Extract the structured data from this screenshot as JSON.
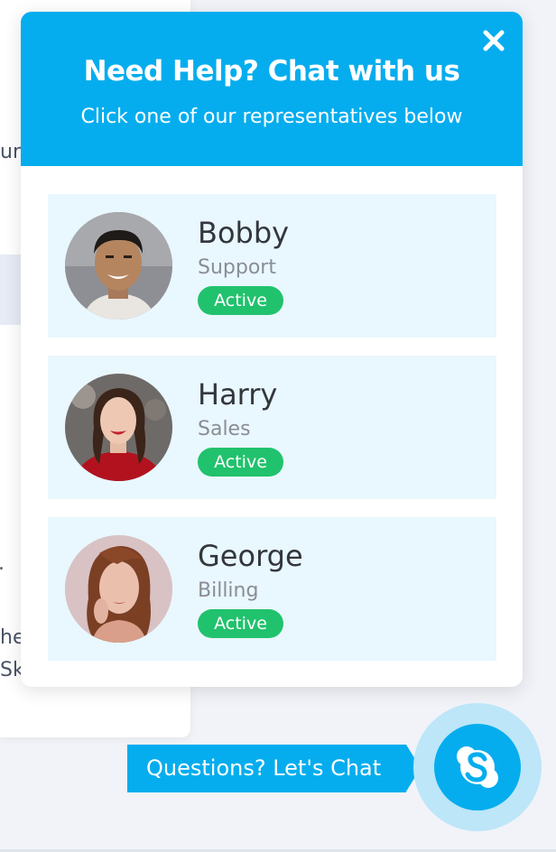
{
  "background": {
    "fragments": [
      "uri",
      ".",
      "he",
      "Sk"
    ]
  },
  "widget": {
    "title": "Need Help? Chat with us",
    "subtitle": "Click one of our representatives below",
    "close_icon": "close-icon",
    "agents": [
      {
        "name": "Bobby",
        "role": "Support",
        "status": "Active",
        "avatar": "man-portrait"
      },
      {
        "name": "Harry",
        "role": "Sales",
        "status": "Active",
        "avatar": "woman-red-top-portrait"
      },
      {
        "name": "George",
        "role": "Billing",
        "status": "Active",
        "avatar": "woman-brown-hair-portrait"
      }
    ]
  },
  "launcher": {
    "cta_label": "Questions? Let's Chat",
    "icon": "skype-icon"
  },
  "colors": {
    "accent": "#05adee",
    "status_active": "#21c26d",
    "card_bg": "#e9f7fe"
  }
}
